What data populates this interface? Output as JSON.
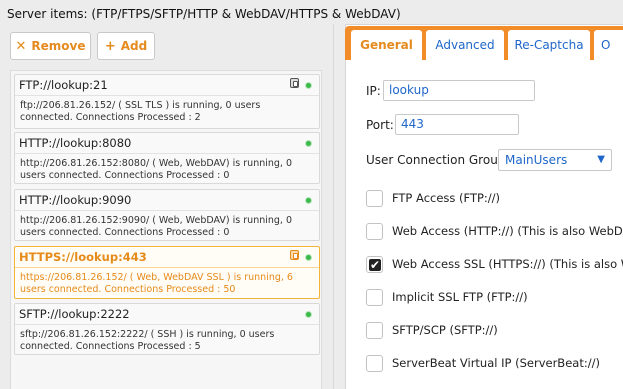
{
  "header": {
    "title": "Server items: (FTP/FTPS/SFTP/HTTP & WebDAV/HTTPS & WebDAV)"
  },
  "toolbar": {
    "remove_label": "Remove",
    "remove_icon": "✕",
    "add_label": "Add",
    "add_icon": "+"
  },
  "servers": [
    {
      "title": "FTP://lookup:21",
      "desc": "ftp://206.81.26.152/ ( SSL TLS ) is running, 0 users connected. Connections Processed : 2",
      "selected": false
    },
    {
      "title": "HTTP://lookup:8080",
      "desc": "http://206.81.26.152:8080/ ( Web, WebDAV) is running, 0 users connected. Connections Processed : 0",
      "selected": false
    },
    {
      "title": "HTTP://lookup:9090",
      "desc": "http://206.81.26.152:9090/ ( Web, WebDAV) is running, 0 users connected. Connections Processed : 0",
      "selected": false
    },
    {
      "title": "HTTPS://lookup:443",
      "desc": "https://206.81.26.152/ ( Web, WebDAV SSL ) is running, 6 users connected. Connections Processed : 50",
      "selected": true
    },
    {
      "title": "SFTP://lookup:2222",
      "desc": "sftp://206.81.26.152:2222/ ( SSH ) is running, 0 users connected. Connections Processed : 5",
      "selected": false
    }
  ],
  "tabs": [
    {
      "label": "General",
      "active": true
    },
    {
      "label": "Advanced",
      "active": false
    },
    {
      "label": "Re-Captcha",
      "active": false
    },
    {
      "label": "O",
      "active": false
    }
  ],
  "form": {
    "ip_label": "IP:",
    "ip_value": "lookup",
    "port_label": "Port:",
    "port_value": "443",
    "group_label": "User Connection Group:",
    "group_value": "MainUsers"
  },
  "checkboxes": [
    {
      "label": "FTP Access (FTP://)",
      "checked": false
    },
    {
      "label": "Web Access (HTTP://) (This is also WebDAV",
      "checked": false
    },
    {
      "label": "Web Access SSL (HTTPS://) (This is also We",
      "checked": true
    },
    {
      "label": "Implicit SSL FTP (FTP://)",
      "checked": false
    },
    {
      "label": "SFTP/SCP (SFTP://)",
      "checked": false
    },
    {
      "label": "ServerBeat Virtual IP (ServerBeat://)",
      "checked": false
    }
  ],
  "colors": {
    "accent": "#e58a1e",
    "tabbar": "#f28c28",
    "link": "#1e66c9",
    "running": "#3cb94b"
  }
}
